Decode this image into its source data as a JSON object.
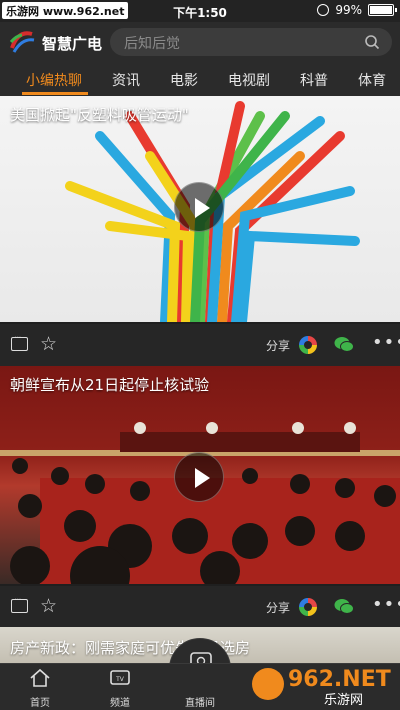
{
  "status_bar": {
    "watermark": "乐游网 www.962.net",
    "time": "下午1:50",
    "battery": "99%",
    "battery_level": 0.99
  },
  "header": {
    "app_title": "智慧广电",
    "search_placeholder": "后知后觉"
  },
  "tabs": [
    "小编热聊",
    "资讯",
    "电影",
    "电视剧",
    "科普",
    "体育"
  ],
  "active_tab": 0,
  "feed": [
    {
      "title": "美国掀起\"反塑料吸管运动\"",
      "share_label": "分享"
    },
    {
      "title": "朝鲜宣布从21日起停止核试验",
      "share_label": "分享"
    },
    {
      "title": "房产新政：刚需家庭可优先摇号选房"
    }
  ],
  "bottom_nav": {
    "home": "首页",
    "channels": "频道",
    "live": "直播间"
  },
  "overlay_watermark": {
    "brand": "962.NET",
    "sub": "乐游网"
  },
  "colors": {
    "accent": "#f08a1d",
    "background": "#1f1f1f",
    "bar": "#2b2b2b"
  }
}
